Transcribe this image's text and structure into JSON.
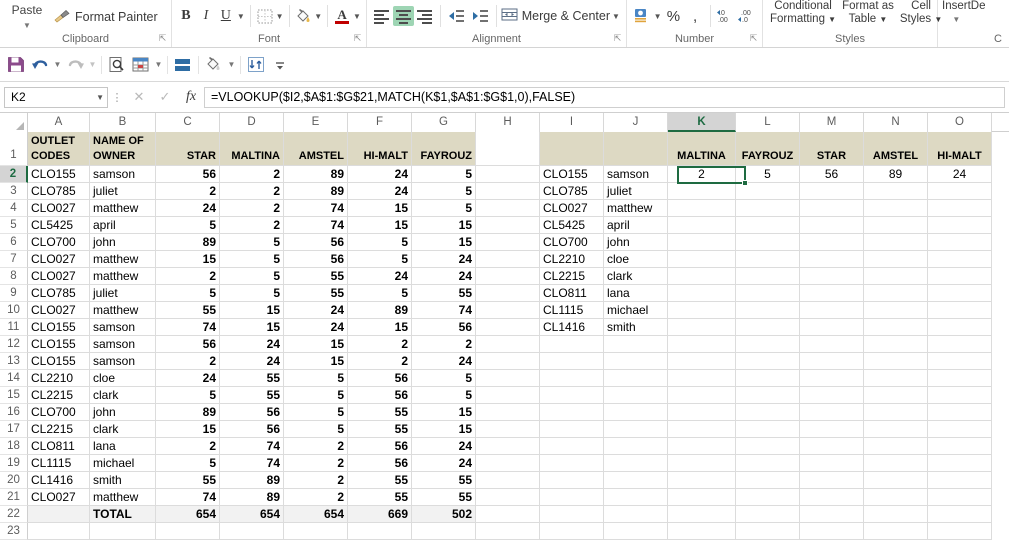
{
  "ribbon": {
    "groups": [
      {
        "name": "clipboard",
        "label": "Clipboard",
        "paste_label": "Paste",
        "format_painter_label": "Format Painter"
      },
      {
        "name": "font",
        "label": "Font",
        "bold": "B",
        "italic": "I",
        "underline": "U"
      },
      {
        "name": "alignment",
        "label": "Alignment",
        "merge_label": "Merge & Center"
      },
      {
        "name": "number",
        "label": "Number",
        "percent": "%",
        "comma": ","
      },
      {
        "name": "styles",
        "label": "Styles",
        "conditional_formatting": [
          "Conditional",
          "Formatting"
        ],
        "format_as_table": [
          "Format as",
          "Table"
        ],
        "cell_styles": [
          "Cell",
          "Styles"
        ]
      },
      {
        "name": "cells",
        "label": "C",
        "insert": "Insert",
        "delete": "De"
      }
    ]
  },
  "quick_access": {
    "buttons": [
      {
        "name": "save-icon"
      },
      {
        "name": "undo-icon"
      },
      {
        "name": "redo-icon"
      },
      {
        "name": "print-preview-icon"
      },
      {
        "name": "format-table-icon"
      },
      {
        "name": "freeze-panes-icon"
      },
      {
        "name": "fill-color-icon"
      },
      {
        "name": "sort-icon"
      },
      {
        "name": "customize-qat-icon"
      }
    ]
  },
  "formula_bar": {
    "name_box_value": "K2",
    "cancel_icon": "✕",
    "confirm_icon": "✓",
    "function_icon": "fx",
    "formula": "=VLOOKUP($I2,$A$1:$G$21,MATCH(K$1,$A$1:$G$1,0),FALSE)"
  },
  "grid": {
    "columns": [
      "A",
      "B",
      "C",
      "D",
      "E",
      "F",
      "G",
      "H",
      "I",
      "J",
      "K",
      "L",
      "M",
      "N",
      "O"
    ],
    "selected_column": "K",
    "selected_row": "2",
    "selected_cell": "K2",
    "rows": [
      "1",
      "2",
      "3",
      "4",
      "5",
      "6",
      "7",
      "8",
      "9",
      "10",
      "11",
      "12",
      "13",
      "14",
      "15",
      "16",
      "17",
      "18",
      "19",
      "20",
      "21",
      "22",
      "23"
    ],
    "left_table": {
      "headers": [
        {
          "line1": "OUTLET",
          "line2": "CODES"
        },
        {
          "line1": "NAME OF",
          "line2": "OWNER"
        },
        {
          "line1": "",
          "line2": "STAR"
        },
        {
          "line1": "",
          "line2": "MALTINA"
        },
        {
          "line1": "",
          "line2": "AMSTEL"
        },
        {
          "line1": "",
          "line2": "HI-MALT"
        },
        {
          "line1": "",
          "line2": "FAYROUZ"
        }
      ],
      "rows": [
        {
          "code": "CLO155",
          "owner": "samson",
          "star": "56",
          "maltina": "2",
          "amstel": "89",
          "himalt": "24",
          "fayrouz": "5"
        },
        {
          "code": "CLO785",
          "owner": "juliet",
          "star": "2",
          "maltina": "2",
          "amstel": "89",
          "himalt": "24",
          "fayrouz": "5"
        },
        {
          "code": "CLO027",
          "owner": "matthew",
          "star": "24",
          "maltina": "2",
          "amstel": "74",
          "himalt": "15",
          "fayrouz": "5"
        },
        {
          "code": "CL5425",
          "owner": "april",
          "star": "5",
          "maltina": "2",
          "amstel": "74",
          "himalt": "15",
          "fayrouz": "15"
        },
        {
          "code": "CLO700",
          "owner": "john",
          "star": "89",
          "maltina": "5",
          "amstel": "56",
          "himalt": "5",
          "fayrouz": "15"
        },
        {
          "code": "CLO027",
          "owner": "matthew",
          "star": "15",
          "maltina": "5",
          "amstel": "56",
          "himalt": "5",
          "fayrouz": "24"
        },
        {
          "code": "CLO027",
          "owner": "matthew",
          "star": "2",
          "maltina": "5",
          "amstel": "55",
          "himalt": "24",
          "fayrouz": "24"
        },
        {
          "code": "CLO785",
          "owner": "juliet",
          "star": "5",
          "maltina": "5",
          "amstel": "55",
          "himalt": "5",
          "fayrouz": "55"
        },
        {
          "code": "CLO027",
          "owner": "matthew",
          "star": "55",
          "maltina": "15",
          "amstel": "24",
          "himalt": "89",
          "fayrouz": "74"
        },
        {
          "code": "CLO155",
          "owner": "samson",
          "star": "74",
          "maltina": "15",
          "amstel": "24",
          "himalt": "15",
          "fayrouz": "56"
        },
        {
          "code": "CLO155",
          "owner": "samson",
          "star": "56",
          "maltina": "24",
          "amstel": "15",
          "himalt": "2",
          "fayrouz": "2"
        },
        {
          "code": "CLO155",
          "owner": "samson",
          "star": "2",
          "maltina": "24",
          "amstel": "15",
          "himalt": "2",
          "fayrouz": "24"
        },
        {
          "code": "CL2210",
          "owner": "cloe",
          "star": "24",
          "maltina": "55",
          "amstel": "5",
          "himalt": "56",
          "fayrouz": "5"
        },
        {
          "code": "CL2215",
          "owner": "clark",
          "star": "5",
          "maltina": "55",
          "amstel": "5",
          "himalt": "56",
          "fayrouz": "5"
        },
        {
          "code": "CLO700",
          "owner": "john",
          "star": "89",
          "maltina": "56",
          "amstel": "5",
          "himalt": "55",
          "fayrouz": "15"
        },
        {
          "code": "CL2215",
          "owner": "clark",
          "star": "15",
          "maltina": "56",
          "amstel": "5",
          "himalt": "55",
          "fayrouz": "15"
        },
        {
          "code": "CLO811",
          "owner": "lana",
          "star": "2",
          "maltina": "74",
          "amstel": "2",
          "himalt": "56",
          "fayrouz": "24"
        },
        {
          "code": "CL1115",
          "owner": "michael",
          "star": "5",
          "maltina": "74",
          "amstel": "2",
          "himalt": "56",
          "fayrouz": "24"
        },
        {
          "code": "CL1416",
          "owner": "smith",
          "star": "55",
          "maltina": "89",
          "amstel": "2",
          "himalt": "55",
          "fayrouz": "55"
        },
        {
          "code": "CLO027",
          "owner": "matthew",
          "star": "74",
          "maltina": "89",
          "amstel": "2",
          "himalt": "55",
          "fayrouz": "55"
        }
      ],
      "total_row": {
        "label": "TOTAL",
        "star": "654",
        "maltina": "654",
        "amstel": "654",
        "himalt": "669",
        "fayrouz": "502"
      }
    },
    "right_table": {
      "headers": [
        "",
        "",
        "MALTINA",
        "FAYROUZ",
        "STAR",
        "AMSTEL",
        "HI-MALT"
      ],
      "rows": [
        {
          "code": "CLO155",
          "owner": "samson",
          "maltina": "2",
          "fayrouz": "5",
          "star": "56",
          "amstel": "89",
          "himalt": "24"
        },
        {
          "code": "CLO785",
          "owner": "juliet",
          "maltina": "",
          "fayrouz": "",
          "star": "",
          "amstel": "",
          "himalt": ""
        },
        {
          "code": "CLO027",
          "owner": "matthew",
          "maltina": "",
          "fayrouz": "",
          "star": "",
          "amstel": "",
          "himalt": ""
        },
        {
          "code": "CL5425",
          "owner": "april",
          "maltina": "",
          "fayrouz": "",
          "star": "",
          "amstel": "",
          "himalt": ""
        },
        {
          "code": "CLO700",
          "owner": "john",
          "maltina": "",
          "fayrouz": "",
          "star": "",
          "amstel": "",
          "himalt": ""
        },
        {
          "code": "CL2210",
          "owner": "cloe",
          "maltina": "",
          "fayrouz": "",
          "star": "",
          "amstel": "",
          "himalt": ""
        },
        {
          "code": "CL2215",
          "owner": "clark",
          "maltina": "",
          "fayrouz": "",
          "star": "",
          "amstel": "",
          "himalt": ""
        },
        {
          "code": "CLO811",
          "owner": "lana",
          "maltina": "",
          "fayrouz": "",
          "star": "",
          "amstel": "",
          "himalt": ""
        },
        {
          "code": "CL1115",
          "owner": "michael",
          "maltina": "",
          "fayrouz": "",
          "star": "",
          "amstel": "",
          "himalt": ""
        },
        {
          "code": "CL1416",
          "owner": "smith",
          "maltina": "",
          "fayrouz": "",
          "star": "",
          "amstel": "",
          "himalt": ""
        }
      ]
    }
  },
  "colors": {
    "header_fill": "#ddd9c3",
    "total_fill": "#f2f2f2",
    "selection_green": "#1e6b41",
    "ribbon_active_green": "#9ed5b4"
  }
}
